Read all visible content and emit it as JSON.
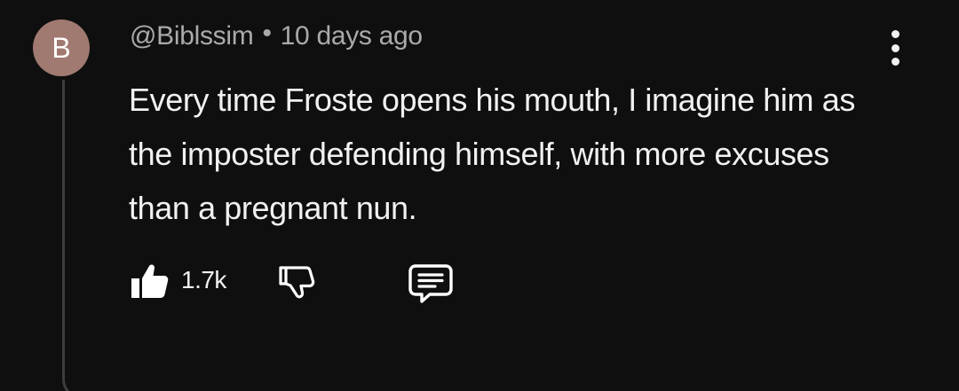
{
  "comment": {
    "avatar_letter": "B",
    "author": "@Biblssim",
    "separator": "•",
    "timestamp": "10 days ago",
    "text": "Every time Froste opens his mouth, I imagine him as the imposter defending himself, with more excuses than a pregnant nun."
  },
  "actions": {
    "like_count": "1.7k",
    "like_icon": "thumbs-up-icon",
    "dislike_icon": "thumbs-down-icon",
    "reply_icon": "comment-icon"
  },
  "menu": {
    "icon": "kebab-menu-icon"
  },
  "colors": {
    "background": "#0f0f0f",
    "avatar": "#a07a70",
    "text": "#f1f1f1",
    "meta": "#aaaaaa"
  }
}
